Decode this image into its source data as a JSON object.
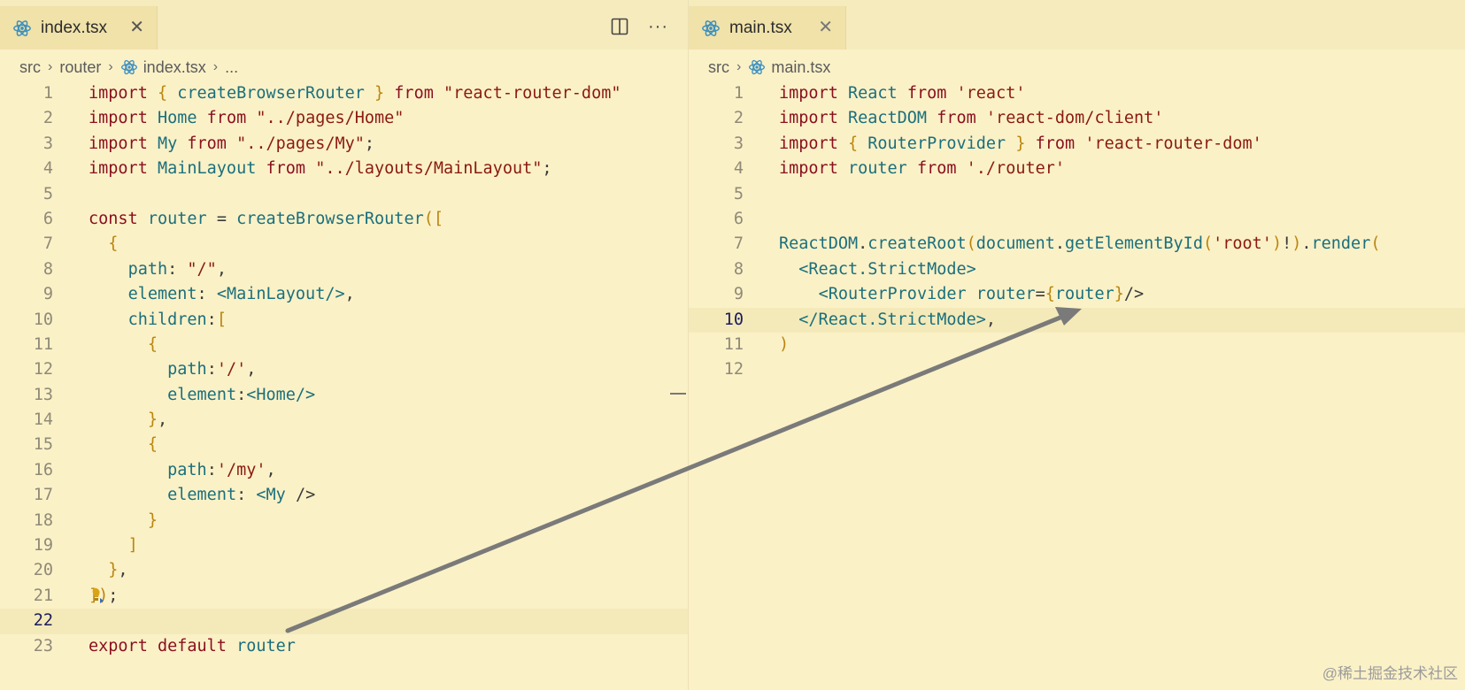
{
  "left_editor": {
    "tab_label": "index.tsx",
    "breadcrumb": [
      "src",
      "router",
      "index.tsx",
      "..."
    ],
    "code": [
      {
        "n": "1",
        "t": "import { createBrowserRouter } from \"react-router-dom\""
      },
      {
        "n": "2",
        "t": "import Home from \"../pages/Home\""
      },
      {
        "n": "3",
        "t": "import My from \"../pages/My\";"
      },
      {
        "n": "4",
        "t": "import MainLayout from \"../layouts/MainLayout\";"
      },
      {
        "n": "5",
        "t": ""
      },
      {
        "n": "6",
        "t": "const router = createBrowserRouter(["
      },
      {
        "n": "7",
        "t": "  {"
      },
      {
        "n": "8",
        "t": "    path: \"/\","
      },
      {
        "n": "9",
        "t": "    element: <MainLayout/>,"
      },
      {
        "n": "10",
        "t": "    children:["
      },
      {
        "n": "11",
        "t": "      {"
      },
      {
        "n": "12",
        "t": "        path:'/',"
      },
      {
        "n": "13",
        "t": "        element:<Home/>"
      },
      {
        "n": "14",
        "t": "      },"
      },
      {
        "n": "15",
        "t": "      {"
      },
      {
        "n": "16",
        "t": "        path:'/my',"
      },
      {
        "n": "17",
        "t": "        element: <My />"
      },
      {
        "n": "18",
        "t": "      }"
      },
      {
        "n": "19",
        "t": "    ]"
      },
      {
        "n": "20",
        "t": "  },"
      },
      {
        "n": "21",
        "t": "]);"
      },
      {
        "n": "22",
        "t": ""
      },
      {
        "n": "23",
        "t": "export default router"
      }
    ],
    "active_line": "22"
  },
  "right_editor": {
    "tab_label": "main.tsx",
    "breadcrumb": [
      "src",
      "main.tsx"
    ],
    "code": [
      {
        "n": "1",
        "t": "import React from 'react'"
      },
      {
        "n": "2",
        "t": "import ReactDOM from 'react-dom/client'"
      },
      {
        "n": "3",
        "t": "import { RouterProvider } from 'react-router-dom'"
      },
      {
        "n": "4",
        "t": "import router from './router'"
      },
      {
        "n": "5",
        "t": ""
      },
      {
        "n": "6",
        "t": ""
      },
      {
        "n": "7",
        "t": "ReactDOM.createRoot(document.getElementById('root')!).render("
      },
      {
        "n": "8",
        "t": "  <React.StrictMode>"
      },
      {
        "n": "9",
        "t": "    <RouterProvider router={router}/>"
      },
      {
        "n": "10",
        "t": "  </React.StrictMode>,"
      },
      {
        "n": "11",
        "t": ")"
      },
      {
        "n": "12",
        "t": ""
      }
    ],
    "active_line": "10"
  },
  "icons": {
    "file": "react-icon",
    "close": "close-icon",
    "split": "split-editor-icon",
    "more": "more-actions-icon",
    "lightbulb": "lightbulb-icon"
  },
  "glyphs": {
    "close": "✕",
    "more": "···",
    "sep": "›"
  },
  "watermark": "@稀土掘金技术社区",
  "colors": {
    "background": "#fbf1c7",
    "keyword": "#8a0f1f",
    "identifier": "#1b6f7c",
    "string": "#8a1a12",
    "bracket": "#b9860e",
    "arrow": "#7a7a7a"
  }
}
